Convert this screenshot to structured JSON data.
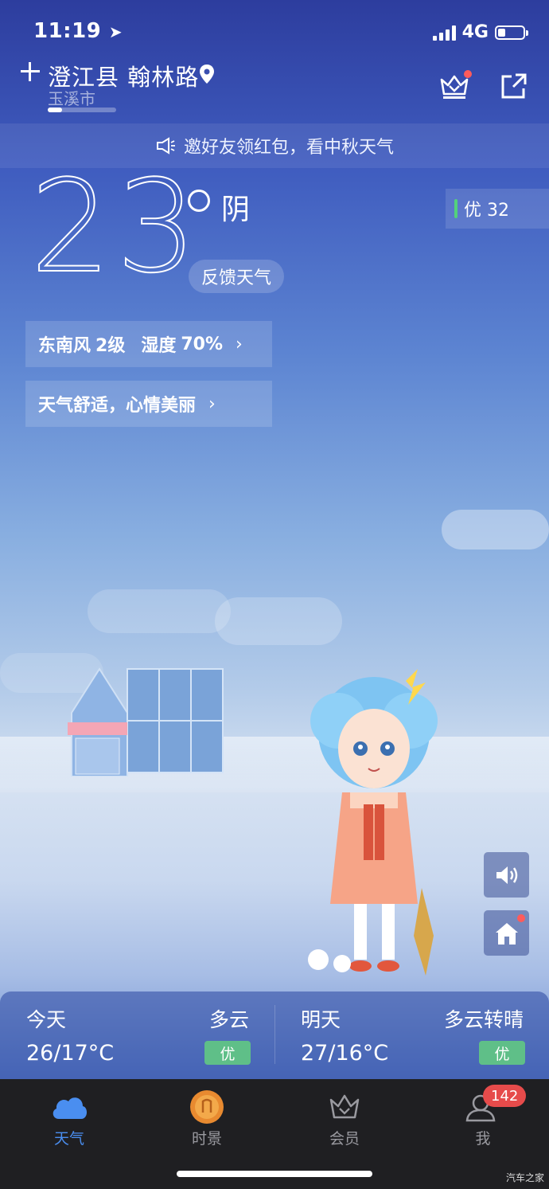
{
  "status_bar": {
    "time": "11:19",
    "network": "4G",
    "battery_level": 0.3
  },
  "header": {
    "location": "澄江县 翰林路",
    "city": "玉溪市"
  },
  "banner": {
    "text": "邀好友领红包，看中秋天气"
  },
  "current": {
    "temperature": "23",
    "condition": "阴",
    "feedback_label": "反馈天气",
    "aqi_label": "优 32",
    "wind": "东南风",
    "wind_level": "2级",
    "humidity_label": "湿度",
    "humidity": "70%",
    "tip": "天气舒适，心情美丽"
  },
  "forecast": {
    "today": {
      "label": "今天",
      "condition": "多云",
      "temp": "26/17°C",
      "aqi": "优"
    },
    "tomorrow": {
      "label": "明天",
      "condition": "多云转晴",
      "temp": "27/16°C",
      "aqi": "优"
    }
  },
  "tabs": [
    {
      "label": "天气",
      "icon": "cloud-icon",
      "active": true
    },
    {
      "label": "时景",
      "icon": "mooncake-icon",
      "active": false
    },
    {
      "label": "会员",
      "icon": "crown-icon",
      "active": false
    },
    {
      "label": "我",
      "icon": "user-icon",
      "active": false
    }
  ],
  "profile_badge": "142",
  "watermark": "汽车之家",
  "colors": {
    "accent": "#4a8ef0",
    "aqi_good": "#5fbf88",
    "badge": "#e64b4b"
  }
}
